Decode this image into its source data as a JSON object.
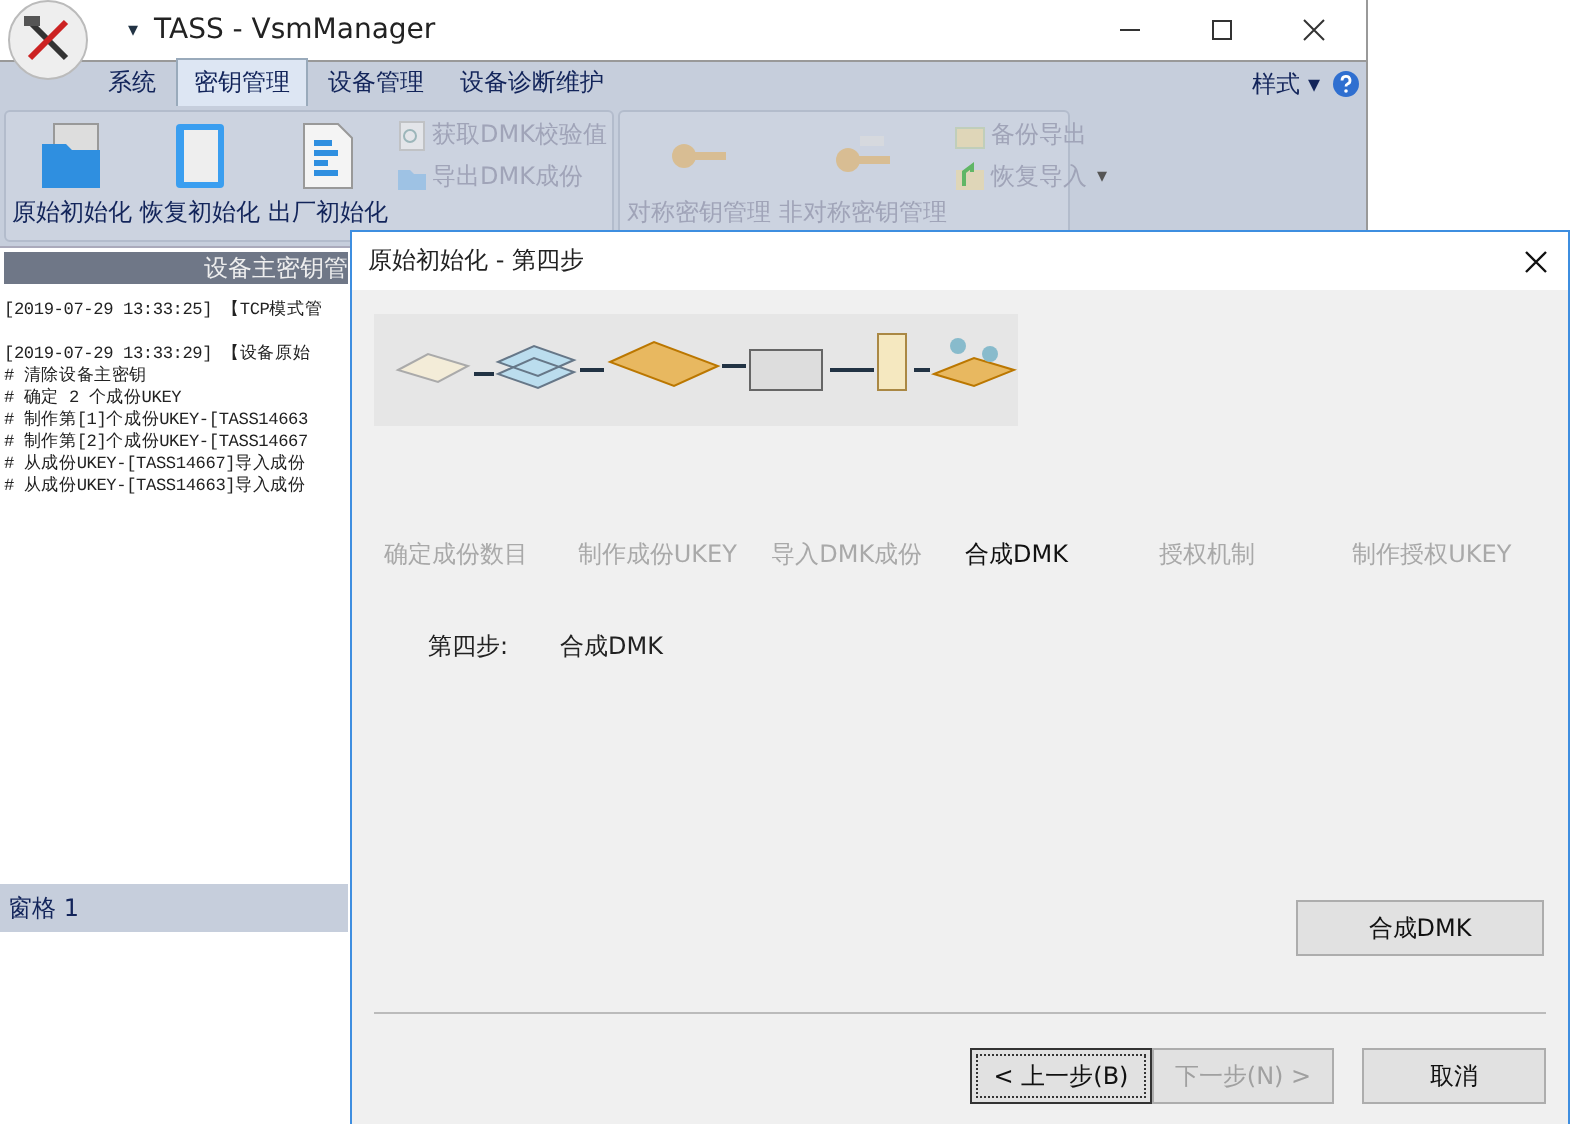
{
  "window": {
    "title": "TASS - VsmManager",
    "quick_access_caret": "▾"
  },
  "tabs": [
    {
      "label": "系统",
      "selected": false
    },
    {
      "label": "密钥管理",
      "selected": true
    },
    {
      "label": "设备管理",
      "selected": false
    },
    {
      "label": "设备诊断维护",
      "selected": false
    }
  ],
  "style_menu": {
    "label": "样式",
    "caret": "▾"
  },
  "ribbon_groups": [
    {
      "label": "设备主密钥管",
      "items": [
        {
          "kind": "large",
          "label": "原始初始化",
          "disabled": false
        },
        {
          "kind": "large",
          "label": "恢复初始化",
          "disabled": false
        },
        {
          "kind": "large",
          "label": "出厂初始化",
          "disabled": false
        },
        {
          "kind": "small",
          "label": "获取DMK校验值",
          "disabled": true
        },
        {
          "kind": "small",
          "label": "导出DMK成份",
          "disabled": true
        }
      ]
    },
    {
      "items": [
        {
          "kind": "large",
          "label": "对称密钥管理",
          "disabled": true
        },
        {
          "kind": "large",
          "label": "非对称密钥管理",
          "disabled": true
        },
        {
          "kind": "small",
          "label": "备份导出",
          "disabled": true
        },
        {
          "kind": "small",
          "label": "恢复导入",
          "disabled": true,
          "caret": "▾"
        }
      ]
    }
  ],
  "log": [
    {
      "header": "[2019-07-29 13:33:25] 【TCP模式管"
    },
    {
      "header": "[2019-07-29 13:33:29] 【设备原始",
      "lines": [
        "# 清除设备主密钥",
        "# 确定 2 个成份UKEY",
        "# 制作第[1]个成份UKEY-[TASS14663",
        "# 制作第[2]个成份UKEY-[TASS14667",
        "# 从成份UKEY-[TASS14667]导入成份",
        "# 从成份UKEY-[TASS14663]导入成份"
      ]
    }
  ],
  "status_bar": "窗格 1",
  "dialog": {
    "title": "原始初始化 - 第四步",
    "steps": [
      {
        "label": "确定成份数目",
        "selected": false
      },
      {
        "label": "制作成份UKEY",
        "selected": false
      },
      {
        "label": "导入DMK成份",
        "selected": false
      },
      {
        "label": "合成DMK",
        "selected": true
      },
      {
        "label": "授权机制",
        "selected": false
      },
      {
        "label": "制作授权UKEY",
        "selected": false
      }
    ],
    "step_caption": "第四步:",
    "step_name": "合成DMK",
    "action_button": "合成DMK",
    "buttons": [
      {
        "label": "< 上一步(B)",
        "disabled": false,
        "focused": true
      },
      {
        "label": "下一步(N) >",
        "disabled": true,
        "focused": false
      },
      {
        "label": "取消",
        "disabled": false,
        "focused": false
      }
    ]
  }
}
